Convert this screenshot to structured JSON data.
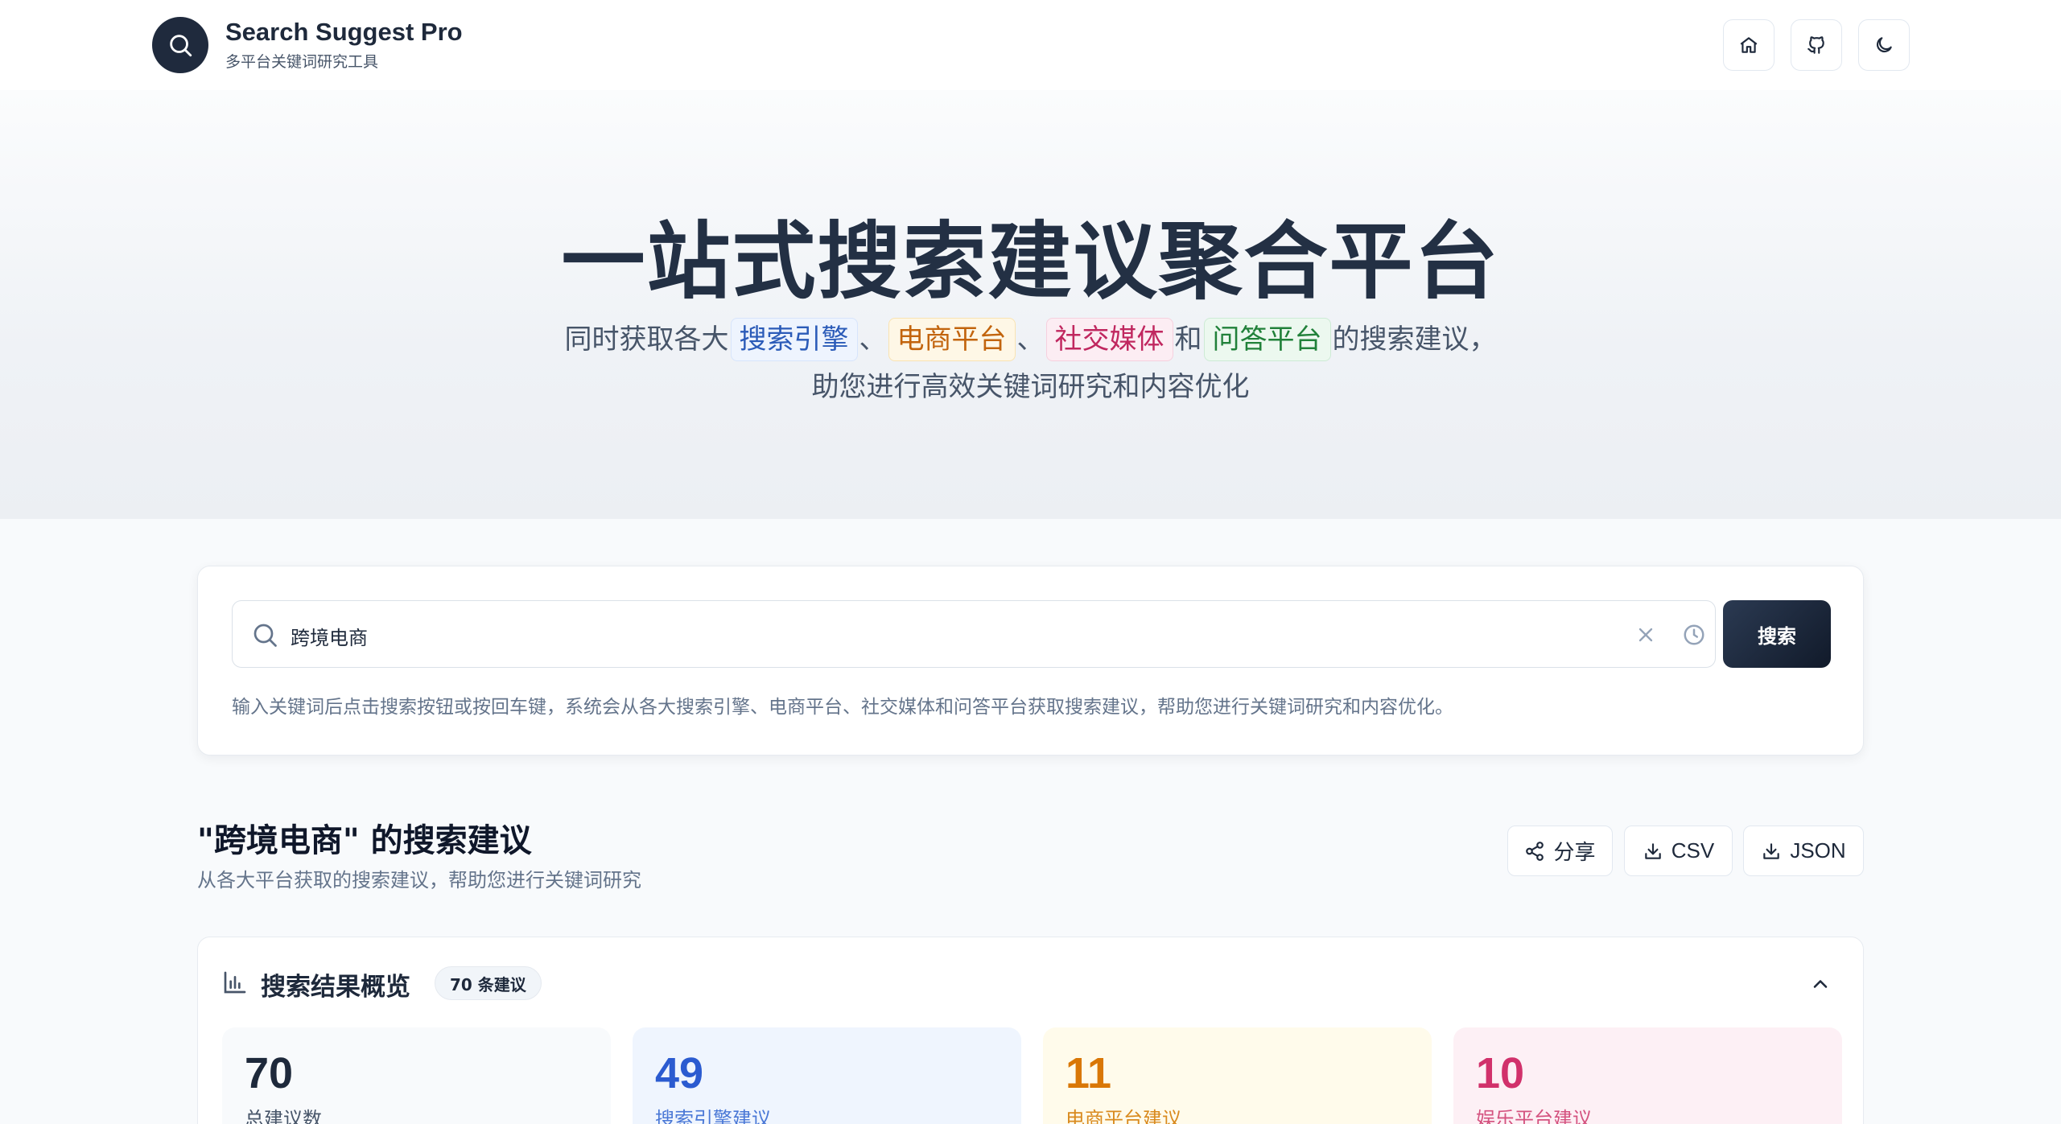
{
  "header": {
    "brand_title": "Search Suggest Pro",
    "brand_subtitle": "多平台关键词研究工具",
    "icons": [
      "search-icon",
      "home-icon",
      "github-icon",
      "moon-icon"
    ]
  },
  "hero": {
    "title": "一站式搜索建议聚合平台",
    "subtitle_prefix": "同时获取各大",
    "tag_search": "搜索引擎",
    "sep1": "、",
    "tag_ecommerce": "电商平台",
    "sep2": "、",
    "tag_social": "社交媒体",
    "conj": "和",
    "tag_qa": "问答平台",
    "subtitle_suffix": "的搜索建议，",
    "subtitle_line2": "助您进行高效关键词研究和内容优化"
  },
  "search": {
    "value": "跨境电商",
    "button_label": "搜索",
    "hint": "输入关键词后点击搜索按钮或按回车键，系统会从各大搜索引擎、电商平台、社交媒体和问答平台获取搜索建议，帮助您进行关键词研究和内容优化。"
  },
  "results": {
    "title": "\"跨境电商\" 的搜索建议",
    "subtitle": "从各大平台获取的搜索建议，帮助您进行关键词研究",
    "share_label": "分享",
    "csv_label": "CSV",
    "json_label": "JSON"
  },
  "overview": {
    "title": "搜索结果概览",
    "badge": "70 条建议",
    "stats": [
      {
        "value": "70",
        "label": "总建议数"
      },
      {
        "value": "49",
        "label": "搜索引擎建议"
      },
      {
        "value": "11",
        "label": "电商平台建议"
      },
      {
        "value": "10",
        "label": "娱乐平台建议"
      }
    ]
  },
  "colors": {
    "primary_dark": "#1f2a3d",
    "search_blue": "#2b5bb8",
    "ecommerce_orange": "#c2640d",
    "social_pink": "#c0275f",
    "qa_green": "#21813a"
  }
}
